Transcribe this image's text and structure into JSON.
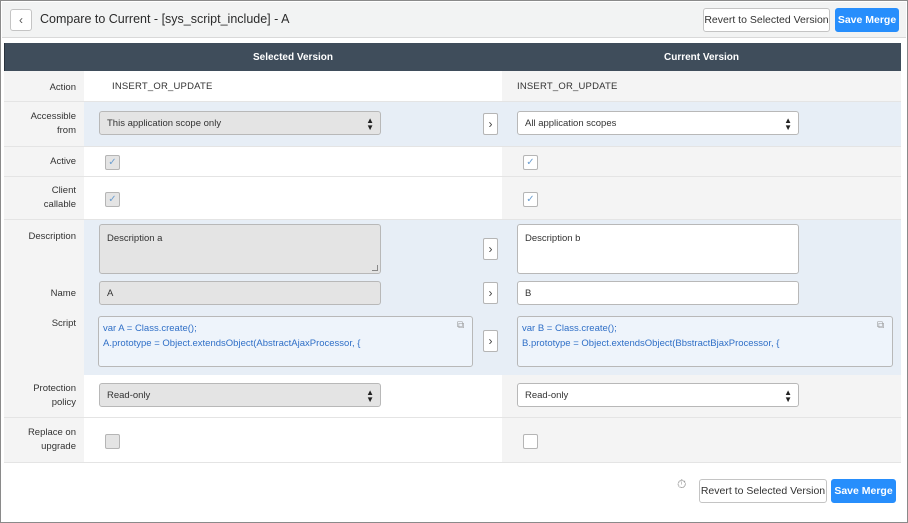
{
  "header": {
    "title": "Compare to Current - [sys_script_include] - A",
    "revert_label": "Revert to Selected Version",
    "save_label": "Save Merge"
  },
  "columns": {
    "selected": "Selected Version",
    "current": "Current Version"
  },
  "fields": {
    "action": {
      "label": "Action",
      "selected": "INSERT_OR_UPDATE",
      "current": "INSERT_OR_UPDATE"
    },
    "accessible_from": {
      "label": "Accessible from",
      "label_l1": "Accessible",
      "label_l2": "from",
      "selected": "This application scope only",
      "current": "All application scopes"
    },
    "active": {
      "label": "Active",
      "selected": true,
      "current": true
    },
    "client_callable": {
      "label_l1": "Client",
      "label_l2": "callable",
      "selected": true,
      "current": true
    },
    "description": {
      "label": "Description",
      "selected": "Description a",
      "current": "Description b"
    },
    "name": {
      "label": "Name",
      "selected": "A",
      "current": "B"
    },
    "script": {
      "label": "Script",
      "selected_l1": "var A = Class.create();",
      "selected_l2": "A.prototype = Object.extendsObject(AbstractAjaxProcessor, {",
      "current_l1": "var B = Class.create();",
      "current_l2": "B.prototype = Object.extendsObject(BbstractBjaxProcessor, {"
    },
    "protection_policy": {
      "label_l1": "Protection",
      "label_l2": "policy",
      "selected": "Read-only",
      "current": "Read-only"
    },
    "replace_on_upgrade": {
      "label_l1": "Replace on",
      "label_l2": "upgrade",
      "selected": false,
      "current": false
    }
  },
  "icons": {
    "back": "chevron-left-icon",
    "copy": "chevron-right-icon",
    "caret": "select-caret-icon",
    "check": "checkmark-icon",
    "popout": "popout-icon",
    "timer": "stopwatch-icon"
  },
  "colors": {
    "primary": "#278efc",
    "header_bg": "#3f4d5b",
    "diff_bg": "#e7eef6",
    "script_text": "#2f6fc7"
  },
  "footer": {
    "revert_label": "Revert to Selected Version",
    "save_label": "Save Merge"
  }
}
